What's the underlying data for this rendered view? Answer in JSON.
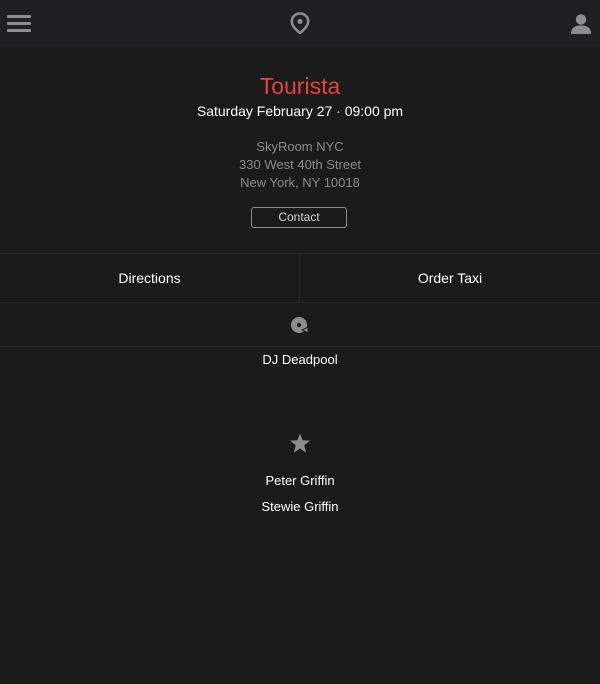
{
  "header": {
    "menu_icon": "hamburger-menu-icon",
    "logo_icon": "location-pin-logo-icon",
    "user_icon": "user-profile-icon"
  },
  "event": {
    "title": "Tourista",
    "date": "Saturday February 27 · 09:00 pm",
    "title_color": "#e5443b"
  },
  "venue": {
    "name": "SkyRoom NYC",
    "street": "330 West 40th Street",
    "city": "New York, NY 10018"
  },
  "contact": {
    "label": "Contact"
  },
  "actions": {
    "directions": "Directions",
    "order_taxi": "Order Taxi"
  },
  "dj": {
    "icon": "vinyl-record-icon",
    "name": "DJ Deadpool"
  },
  "guests": {
    "icon": "star-icon",
    "list": [
      "Peter Griffin",
      "Stewie Griffin"
    ]
  }
}
